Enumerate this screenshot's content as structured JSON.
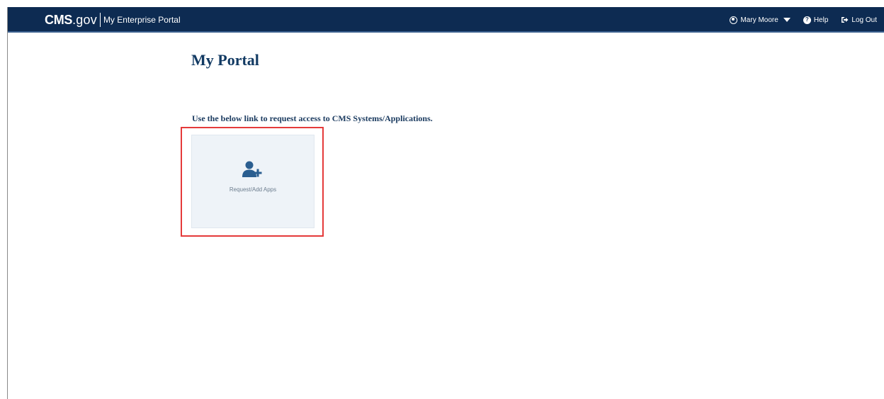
{
  "header": {
    "brand_cms": "CMS",
    "brand_gov": ".gov",
    "portal_name": "My Enterprise Portal",
    "user_name": "Mary Moore",
    "help_label": "Help",
    "logout_label": "Log Out",
    "user_icon": "user-circle-icon",
    "help_icon": "question-circle-icon",
    "logout_icon": "sign-out-icon"
  },
  "main": {
    "title": "My Portal",
    "intro_text": "Use the below link to request access to CMS Systems/Applications.",
    "tile": {
      "label": "Request/Add Apps",
      "icon": "user-plus-icon"
    }
  },
  "colors": {
    "header_bg": "#0d2b52",
    "title": "#123a63",
    "highlight": "#e53a3a",
    "tile_bg": "#eef3f8",
    "icon": "#2a5e90"
  }
}
